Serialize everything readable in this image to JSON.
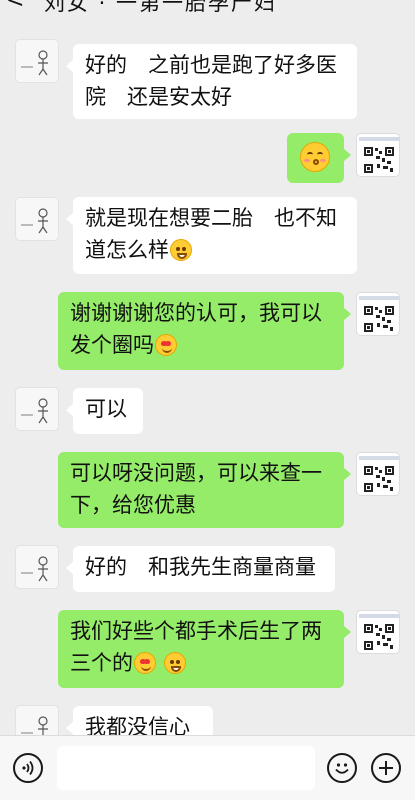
{
  "header": {
    "back_glyph": "<",
    "title": "刘女 · 一第一胎孕产妇"
  },
  "messages": [
    {
      "id": "m1",
      "side": "in",
      "text": "好的　之前也是跑了好多医院　还是安太好"
    },
    {
      "id": "m2",
      "side": "out",
      "emoji": "kissing-face-emoji"
    },
    {
      "id": "m3",
      "side": "in",
      "text": "就是现在想要二胎　也不知道怎么样"
    },
    {
      "id": "m4",
      "side": "out",
      "text": "谢谢谢谢您的认可，我可以发个圈吗"
    },
    {
      "id": "m5",
      "side": "in",
      "text": "可以"
    },
    {
      "id": "m6",
      "side": "out",
      "text": "可以呀没问题，可以来查一下，给您优惠"
    },
    {
      "id": "m7",
      "side": "in",
      "text": "好的　和我先生商量商量"
    },
    {
      "id": "m8",
      "side": "out",
      "text": "我们好些个都手术后生了两三个的"
    },
    {
      "id": "m9",
      "side": "in",
      "text": "我都没信心"
    }
  ],
  "input_bar": {
    "voice_icon": "voice-icon",
    "emoji_icon": "emoji-icon",
    "plus_icon": "plus-icon",
    "input_value": ""
  },
  "colors": {
    "background": "#ededed",
    "incoming_bubble": "#ffffff",
    "outgoing_bubble": "#95ec69"
  }
}
